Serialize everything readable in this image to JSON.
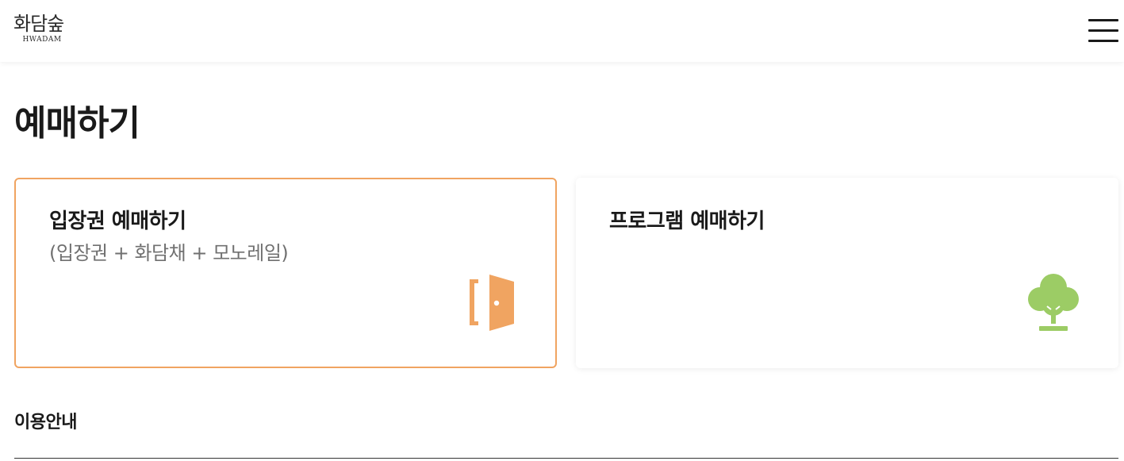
{
  "header": {
    "logo_main": "화담숲",
    "logo_sub": "HWADAM",
    "menu_icon": "hamburger-menu-icon"
  },
  "page": {
    "title": "예매하기"
  },
  "cards": {
    "ticket": {
      "title": "입장권 예매하기",
      "subtitle": "(입장권 + 화담채 + 모노레일)",
      "icon": "door-icon",
      "accent_color": "#f0a461"
    },
    "program": {
      "title": "프로그램 예매하기",
      "icon": "tree-icon",
      "accent_color": "#9ccc65"
    }
  },
  "info": {
    "title": "이용안내"
  }
}
